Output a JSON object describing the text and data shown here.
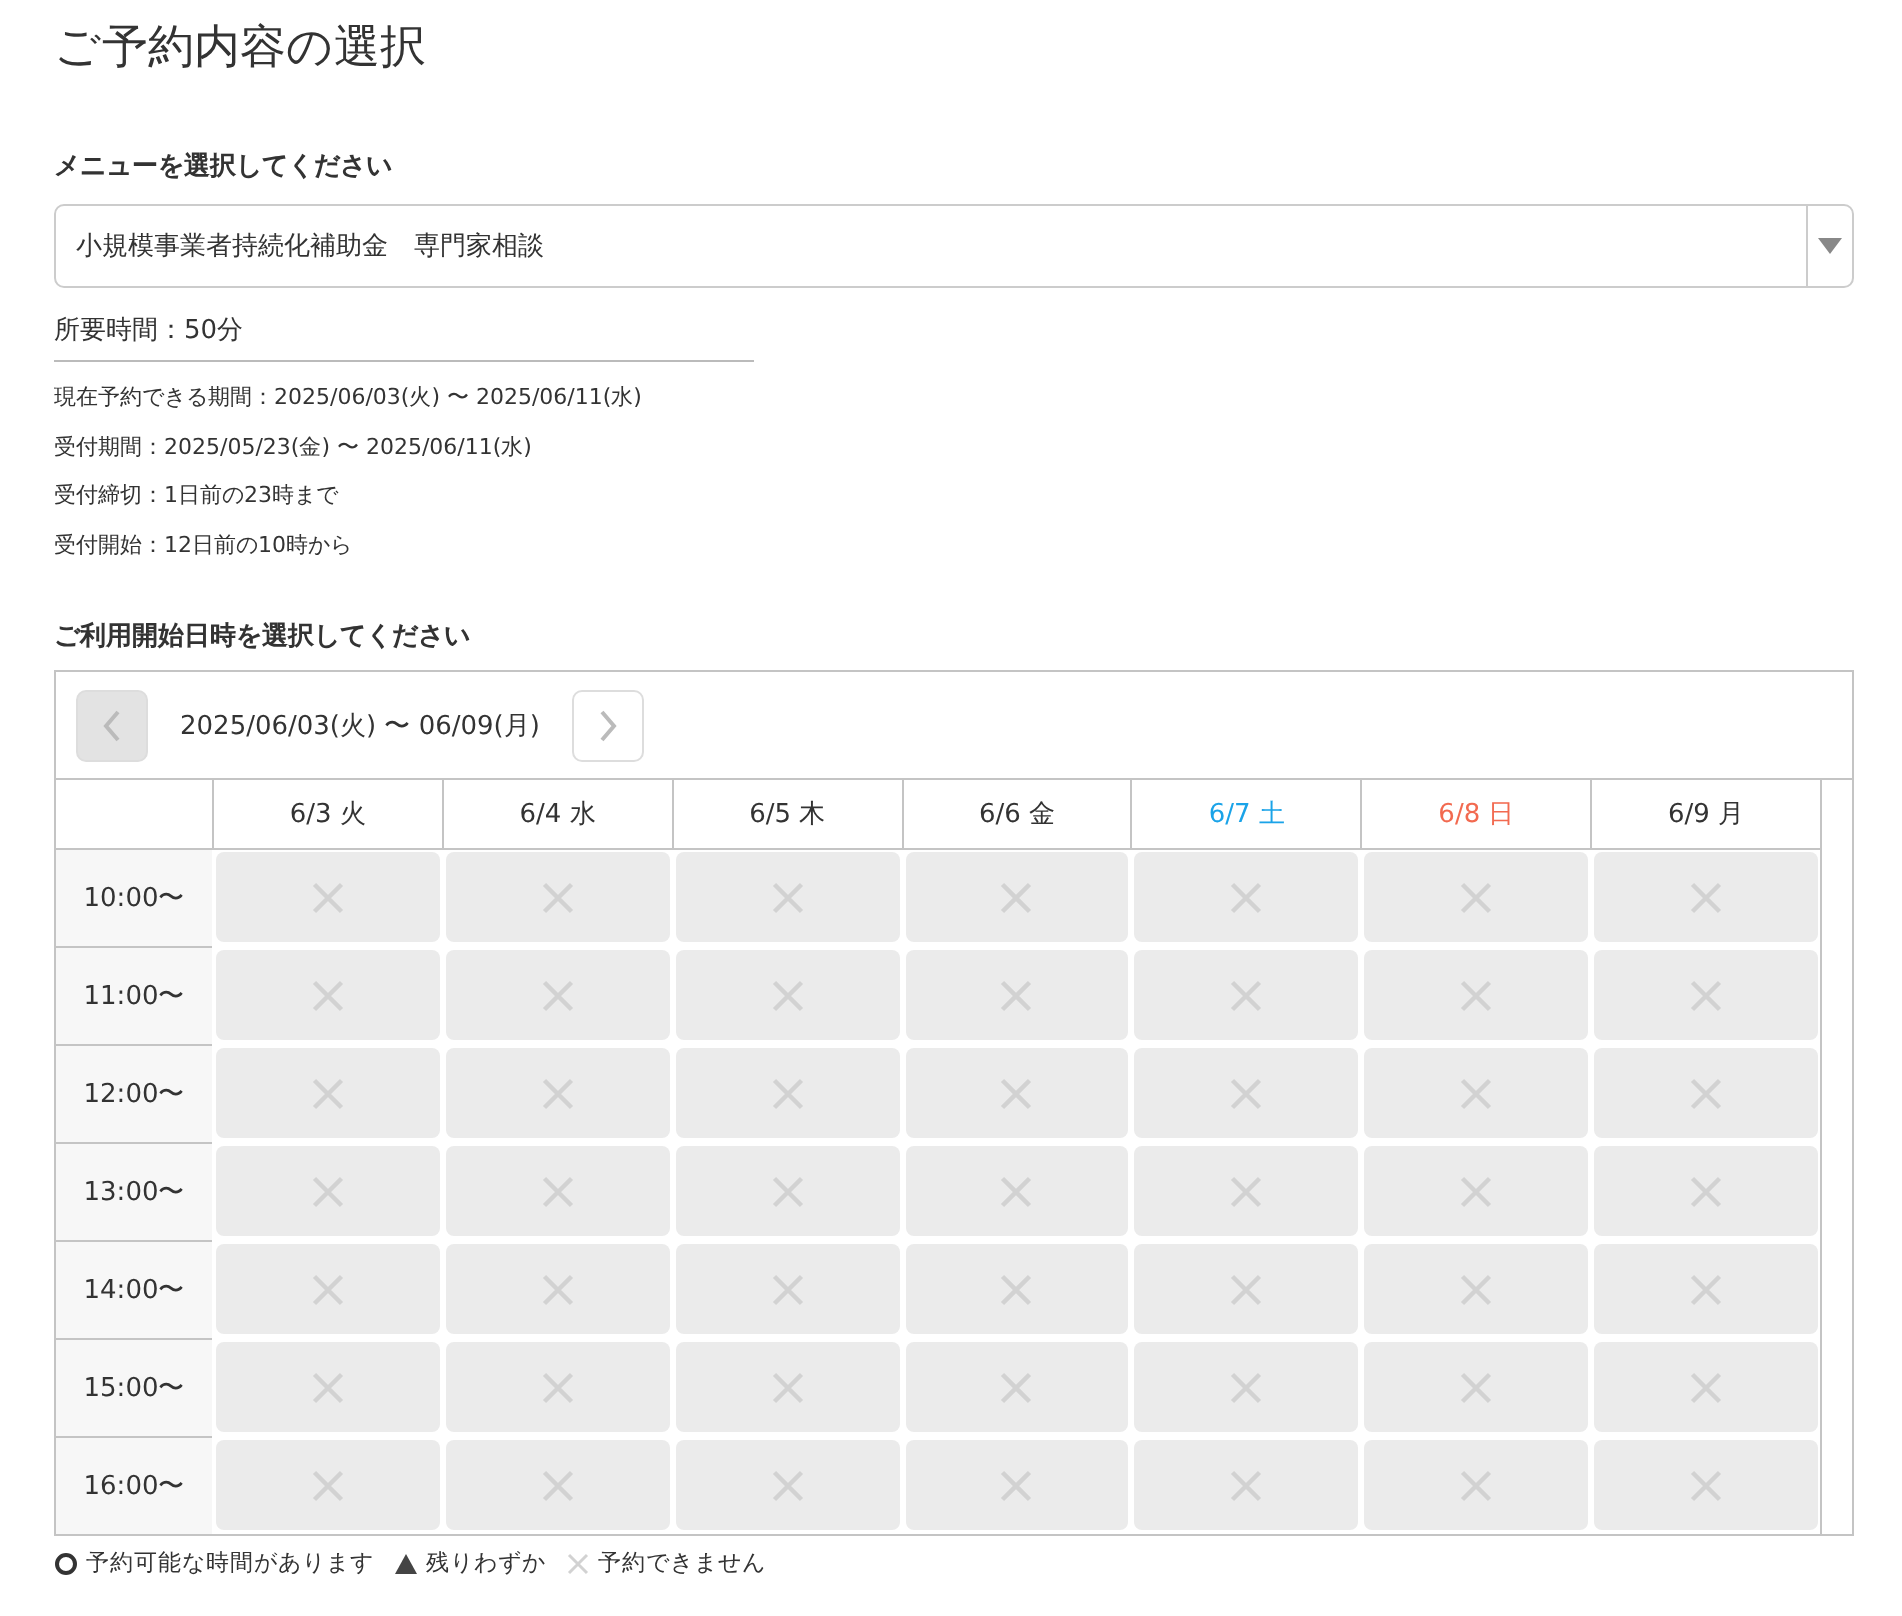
{
  "title": "ご予約内容の選択",
  "menu": {
    "label": "メニューを選択してください",
    "value": "小規模事業者持続化補助金　専門家相談"
  },
  "duration": "所要時間：50分",
  "info": [
    "現在予約できる期間：2025/06/03(火) 〜 2025/06/11(水)",
    "受付期間：2025/05/23(金) 〜 2025/06/11(水)",
    "受付締切：1日前の23時まで",
    "受付開始：12日前の10時から"
  ],
  "schedule": {
    "label": "ご利用開始日時を選択してください",
    "range": "2025/06/03(火) 〜 06/09(月)",
    "prev": {
      "disabled": true
    },
    "next": {
      "disabled": false
    },
    "days": [
      {
        "label": "6/3 火",
        "kind": "weekday"
      },
      {
        "label": "6/4 水",
        "kind": "weekday"
      },
      {
        "label": "6/5 木",
        "kind": "weekday"
      },
      {
        "label": "6/6 金",
        "kind": "weekday"
      },
      {
        "label": "6/7 土",
        "kind": "saturday"
      },
      {
        "label": "6/8 日",
        "kind": "sunday"
      },
      {
        "label": "6/9 月",
        "kind": "weekday"
      }
    ],
    "rows": [
      {
        "time": "10:00〜",
        "slots": [
          {
            "kind": "none"
          },
          {
            "kind": "none"
          },
          {
            "kind": "none"
          },
          {
            "kind": "none"
          },
          {
            "kind": "none"
          },
          {
            "kind": "none"
          },
          {
            "kind": "none"
          }
        ]
      },
      {
        "time": "11:00〜",
        "slots": [
          {
            "kind": "none"
          },
          {
            "kind": "none"
          },
          {
            "kind": "none"
          },
          {
            "kind": "none"
          },
          {
            "kind": "none"
          },
          {
            "kind": "none"
          },
          {
            "kind": "none"
          }
        ]
      },
      {
        "time": "12:00〜",
        "slots": [
          {
            "kind": "none"
          },
          {
            "kind": "none"
          },
          {
            "kind": "none"
          },
          {
            "kind": "none"
          },
          {
            "kind": "none"
          },
          {
            "kind": "none"
          },
          {
            "kind": "none"
          }
        ]
      },
      {
        "time": "13:00〜",
        "slots": [
          {
            "kind": "none"
          },
          {
            "kind": "none"
          },
          {
            "kind": "none"
          },
          {
            "kind": "none"
          },
          {
            "kind": "none"
          },
          {
            "kind": "none"
          },
          {
            "kind": "none"
          }
        ]
      },
      {
        "time": "14:00〜",
        "slots": [
          {
            "kind": "none"
          },
          {
            "kind": "none"
          },
          {
            "kind": "none"
          },
          {
            "kind": "none"
          },
          {
            "kind": "none"
          },
          {
            "kind": "none"
          },
          {
            "kind": "none"
          }
        ]
      },
      {
        "time": "15:00〜",
        "slots": [
          {
            "kind": "none"
          },
          {
            "kind": "none"
          },
          {
            "kind": "none"
          },
          {
            "kind": "none"
          },
          {
            "kind": "none"
          },
          {
            "kind": "none"
          },
          {
            "kind": "none"
          }
        ]
      },
      {
        "time": "16:00〜",
        "slots": [
          {
            "kind": "none"
          },
          {
            "kind": "none"
          },
          {
            "kind": "none"
          },
          {
            "kind": "none"
          },
          {
            "kind": "none"
          },
          {
            "kind": "none"
          },
          {
            "kind": "none"
          }
        ]
      }
    ]
  },
  "legend": [
    {
      "kind": "available",
      "label": "予約可能な時間があります"
    },
    {
      "kind": "few",
      "label": "残りわずか"
    },
    {
      "kind": "none",
      "label": "予約できません"
    }
  ]
}
